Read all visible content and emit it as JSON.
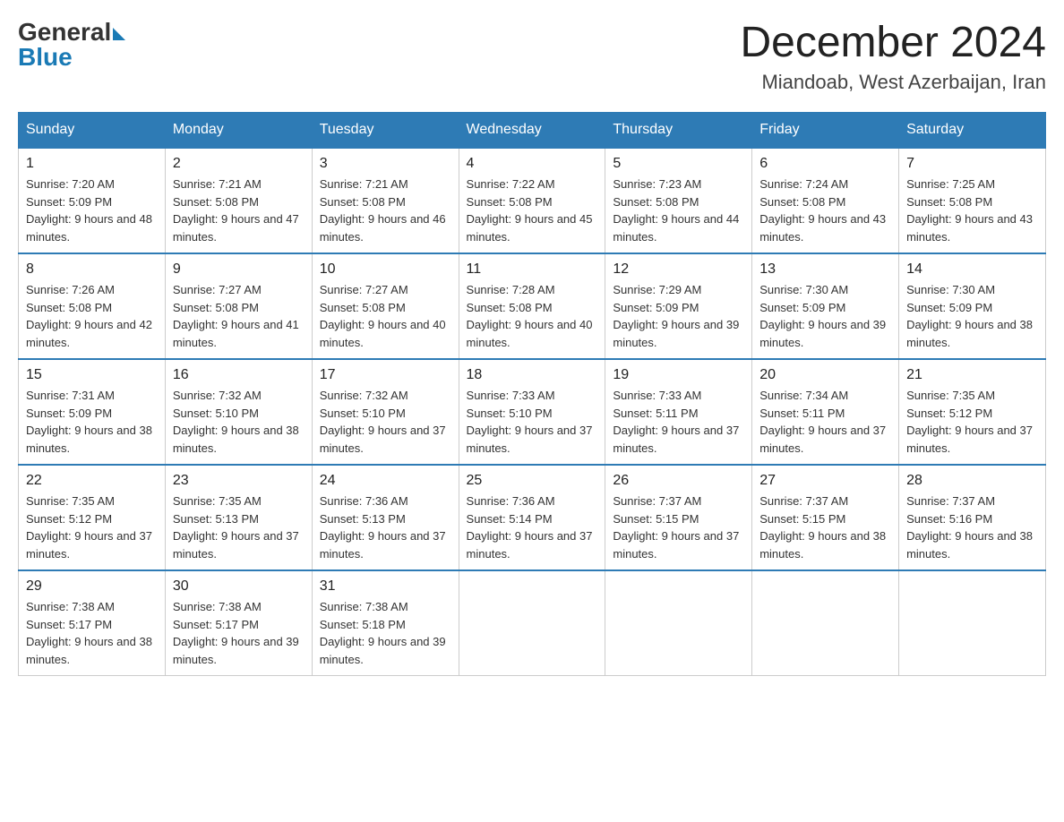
{
  "header": {
    "logo_general": "General",
    "logo_blue": "Blue",
    "month_title": "December 2024",
    "location": "Miandoab, West Azerbaijan, Iran"
  },
  "days_of_week": [
    "Sunday",
    "Monday",
    "Tuesday",
    "Wednesday",
    "Thursday",
    "Friday",
    "Saturday"
  ],
  "weeks": [
    [
      {
        "day": "1",
        "sunrise": "7:20 AM",
        "sunset": "5:09 PM",
        "daylight": "9 hours and 48 minutes."
      },
      {
        "day": "2",
        "sunrise": "7:21 AM",
        "sunset": "5:08 PM",
        "daylight": "9 hours and 47 minutes."
      },
      {
        "day": "3",
        "sunrise": "7:21 AM",
        "sunset": "5:08 PM",
        "daylight": "9 hours and 46 minutes."
      },
      {
        "day": "4",
        "sunrise": "7:22 AM",
        "sunset": "5:08 PM",
        "daylight": "9 hours and 45 minutes."
      },
      {
        "day": "5",
        "sunrise": "7:23 AM",
        "sunset": "5:08 PM",
        "daylight": "9 hours and 44 minutes."
      },
      {
        "day": "6",
        "sunrise": "7:24 AM",
        "sunset": "5:08 PM",
        "daylight": "9 hours and 43 minutes."
      },
      {
        "day": "7",
        "sunrise": "7:25 AM",
        "sunset": "5:08 PM",
        "daylight": "9 hours and 43 minutes."
      }
    ],
    [
      {
        "day": "8",
        "sunrise": "7:26 AM",
        "sunset": "5:08 PM",
        "daylight": "9 hours and 42 minutes."
      },
      {
        "day": "9",
        "sunrise": "7:27 AM",
        "sunset": "5:08 PM",
        "daylight": "9 hours and 41 minutes."
      },
      {
        "day": "10",
        "sunrise": "7:27 AM",
        "sunset": "5:08 PM",
        "daylight": "9 hours and 40 minutes."
      },
      {
        "day": "11",
        "sunrise": "7:28 AM",
        "sunset": "5:08 PM",
        "daylight": "9 hours and 40 minutes."
      },
      {
        "day": "12",
        "sunrise": "7:29 AM",
        "sunset": "5:09 PM",
        "daylight": "9 hours and 39 minutes."
      },
      {
        "day": "13",
        "sunrise": "7:30 AM",
        "sunset": "5:09 PM",
        "daylight": "9 hours and 39 minutes."
      },
      {
        "day": "14",
        "sunrise": "7:30 AM",
        "sunset": "5:09 PM",
        "daylight": "9 hours and 38 minutes."
      }
    ],
    [
      {
        "day": "15",
        "sunrise": "7:31 AM",
        "sunset": "5:09 PM",
        "daylight": "9 hours and 38 minutes."
      },
      {
        "day": "16",
        "sunrise": "7:32 AM",
        "sunset": "5:10 PM",
        "daylight": "9 hours and 38 minutes."
      },
      {
        "day": "17",
        "sunrise": "7:32 AM",
        "sunset": "5:10 PM",
        "daylight": "9 hours and 37 minutes."
      },
      {
        "day": "18",
        "sunrise": "7:33 AM",
        "sunset": "5:10 PM",
        "daylight": "9 hours and 37 minutes."
      },
      {
        "day": "19",
        "sunrise": "7:33 AM",
        "sunset": "5:11 PM",
        "daylight": "9 hours and 37 minutes."
      },
      {
        "day": "20",
        "sunrise": "7:34 AM",
        "sunset": "5:11 PM",
        "daylight": "9 hours and 37 minutes."
      },
      {
        "day": "21",
        "sunrise": "7:35 AM",
        "sunset": "5:12 PM",
        "daylight": "9 hours and 37 minutes."
      }
    ],
    [
      {
        "day": "22",
        "sunrise": "7:35 AM",
        "sunset": "5:12 PM",
        "daylight": "9 hours and 37 minutes."
      },
      {
        "day": "23",
        "sunrise": "7:35 AM",
        "sunset": "5:13 PM",
        "daylight": "9 hours and 37 minutes."
      },
      {
        "day": "24",
        "sunrise": "7:36 AM",
        "sunset": "5:13 PM",
        "daylight": "9 hours and 37 minutes."
      },
      {
        "day": "25",
        "sunrise": "7:36 AM",
        "sunset": "5:14 PM",
        "daylight": "9 hours and 37 minutes."
      },
      {
        "day": "26",
        "sunrise": "7:37 AM",
        "sunset": "5:15 PM",
        "daylight": "9 hours and 37 minutes."
      },
      {
        "day": "27",
        "sunrise": "7:37 AM",
        "sunset": "5:15 PM",
        "daylight": "9 hours and 38 minutes."
      },
      {
        "day": "28",
        "sunrise": "7:37 AM",
        "sunset": "5:16 PM",
        "daylight": "9 hours and 38 minutes."
      }
    ],
    [
      {
        "day": "29",
        "sunrise": "7:38 AM",
        "sunset": "5:17 PM",
        "daylight": "9 hours and 38 minutes."
      },
      {
        "day": "30",
        "sunrise": "7:38 AM",
        "sunset": "5:17 PM",
        "daylight": "9 hours and 39 minutes."
      },
      {
        "day": "31",
        "sunrise": "7:38 AM",
        "sunset": "5:18 PM",
        "daylight": "9 hours and 39 minutes."
      },
      null,
      null,
      null,
      null
    ]
  ]
}
